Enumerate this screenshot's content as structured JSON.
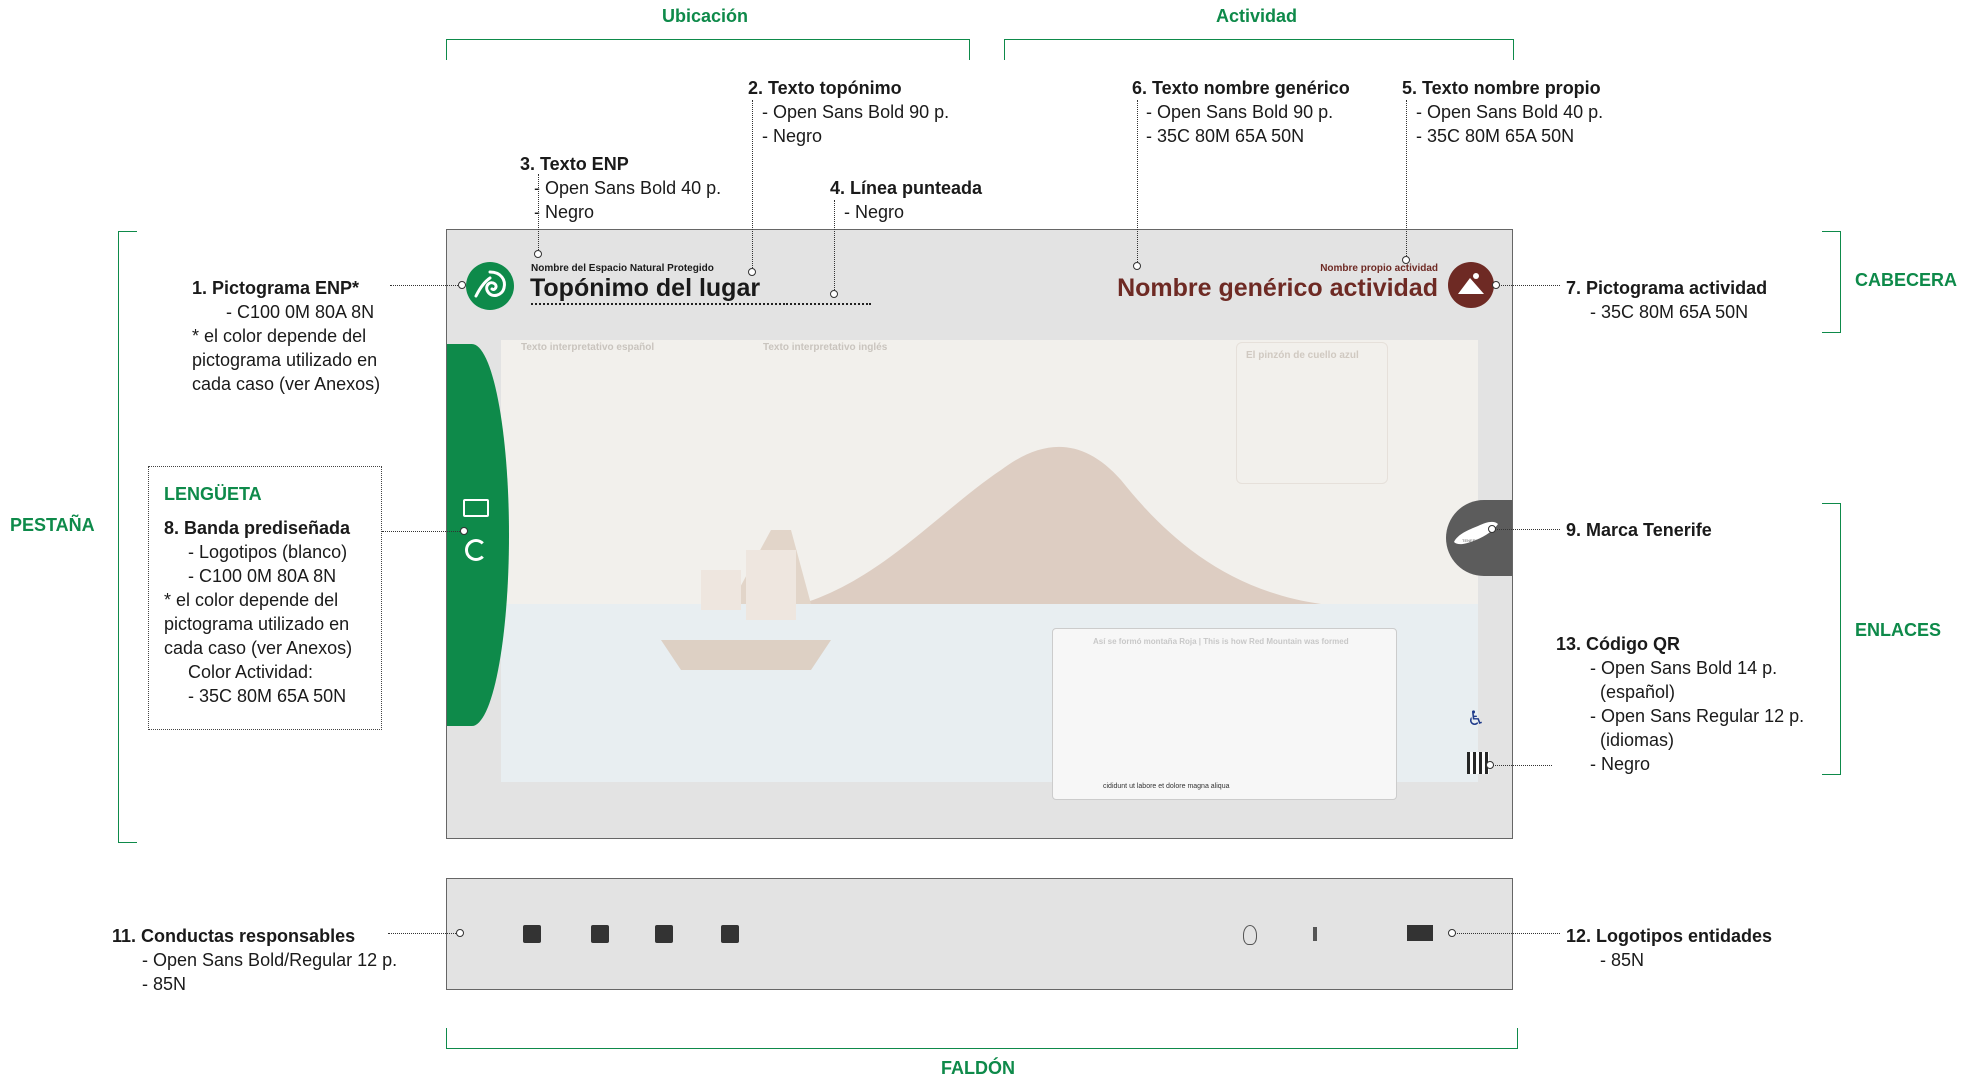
{
  "sections": {
    "ubicacion": "Ubicación",
    "actividad": "Actividad",
    "pestana": "PESTAÑA",
    "cabecera": "CABECERA",
    "enlaces": "ENLACES",
    "faldon": "FALDÓN"
  },
  "callouts": {
    "c1": {
      "title": "1.  Pictograma ENP*",
      "lines": [
        "- C100 0M 80A 8N",
        "* el color depende del",
        "pictograma utilizado en",
        "cada caso (ver Anexos)"
      ]
    },
    "c2": {
      "title": "2. Texto topónimo",
      "lines": [
        "- Open Sans Bold 90 p.",
        "- Negro"
      ]
    },
    "c3": {
      "title": "3. Texto ENP",
      "lines": [
        "- Open Sans Bold 40 p.",
        "- Negro"
      ]
    },
    "c4": {
      "title": "4. Línea punteada",
      "lines": [
        "- Negro"
      ]
    },
    "c5": {
      "title": "5. Texto nombre propio",
      "lines": [
        "- Open Sans Bold 40 p.",
        "- 35C 80M 65A 50N"
      ]
    },
    "c6": {
      "title": "6. Texto nombre genérico",
      "lines": [
        "- Open Sans Bold 90 p.",
        "- 35C 80M 65A 50N"
      ]
    },
    "c7": {
      "title": "7.  Pictograma actividad",
      "lines": [
        "- 35C 80M 65A 50N"
      ]
    },
    "c8": {
      "heading": "LENGÜETA",
      "title": "8. Banda prediseñada",
      "lines": [
        "- Logotipos (blanco)",
        "- C100 0M 80A 8N",
        "* el color depende del",
        "pictograma utilizado en",
        "cada caso (ver Anexos)",
        "Color Actividad:",
        "- 35C 80M 65A 50N"
      ]
    },
    "c9": {
      "title": "9. Marca Tenerife"
    },
    "c11": {
      "title": "11.  Conductas responsables",
      "lines": [
        "- Open Sans Bold/Regular 12 p.",
        "- 85N"
      ]
    },
    "c12": {
      "title": "12. Logotipos entidades",
      "lines": [
        "- 85N"
      ]
    },
    "c13": {
      "title": "13. Código QR",
      "lines": [
        "- Open Sans Bold 14 p.",
        "(español)",
        "- Open Sans Regular 12 p.",
        "(idiomas)",
        "- Negro"
      ]
    }
  },
  "panel": {
    "enp_name": "Nombre del Espacio Natural Protegido",
    "toponym": "Topónimo del lugar",
    "own_name": "Nombre propio actividad",
    "generic_name": "Nombre genérico actividad",
    "tenerife_tag": "TENERIFE",
    "text_es_title": "Texto interpretativo español",
    "text_en_title": "Texto interpretativo inglés",
    "bottom_box_title": "Así se formó montaña Roja  |  This is how Red Mountain was formed",
    "bottom_caption": "cididunt ut labore et dolore magna aliqua",
    "bird_box_title": "El pinzón de cuello azul"
  },
  "colors": {
    "green": "#0e8a4a",
    "brown": "#6e2a24",
    "tenerife_grey": "#5c5c5c",
    "accent_label": "#0e8a4a"
  }
}
